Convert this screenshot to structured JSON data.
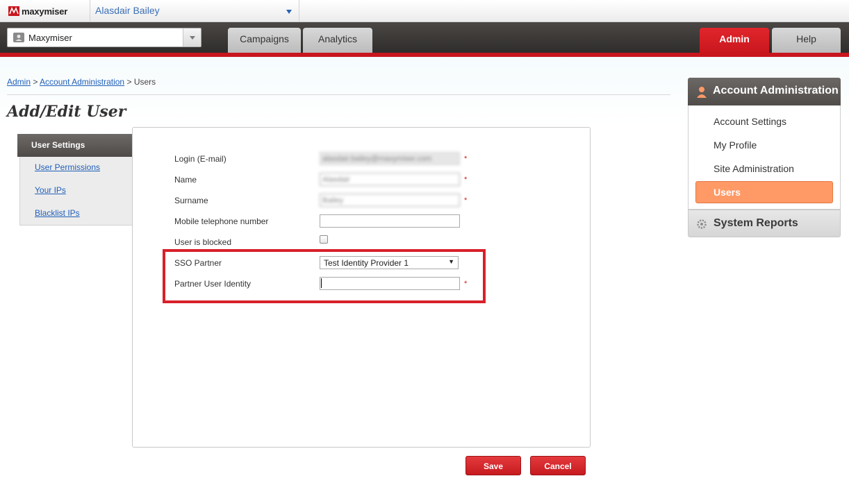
{
  "header": {
    "logo_text": "maxymiser",
    "user_name": "Alasdair Bailey"
  },
  "navbar": {
    "site_name": "Maxymiser",
    "tabs": [
      {
        "label": "Campaigns"
      },
      {
        "label": "Analytics"
      }
    ],
    "right_tabs": [
      {
        "label": "Admin",
        "active": true
      },
      {
        "label": "Help"
      }
    ]
  },
  "breadcrumb": {
    "items": [
      "Admin",
      "Account Administration"
    ],
    "current": "Users",
    "separator": ">"
  },
  "page": {
    "title": "Add/Edit User"
  },
  "subnav": {
    "active": "User Settings",
    "links": [
      "User Permissions",
      "Your IPs",
      "Blacklist IPs"
    ]
  },
  "form": {
    "login_label": "Login (E-mail)",
    "login_value": "alasdair.bailey@maxymiser.com",
    "name_label": "Name",
    "name_value": "Alasdair",
    "surname_label": "Surname",
    "surname_value": "Bailey",
    "mobile_label": "Mobile telephone number",
    "mobile_value": "",
    "blocked_label": "User is blocked",
    "blocked": false,
    "sso_label": "SSO Partner",
    "sso_value": "Test Identity Provider 1",
    "partner_identity_label": "Partner User Identity",
    "partner_identity_value": "",
    "required_mark": "*"
  },
  "buttons": {
    "save": "Save",
    "cancel": "Cancel"
  },
  "right_panel": {
    "title": "Account Administration",
    "items": [
      "Account Settings",
      "My Profile",
      "Site Administration"
    ],
    "active_item": "Users",
    "footer_title": "System Reports"
  },
  "colors": {
    "brand_red": "#c8161d",
    "nav_dark": "#3a3836",
    "link_blue": "#1f5fb8",
    "active_orange": "#ff9966",
    "highlight_red": "#d8202a"
  }
}
